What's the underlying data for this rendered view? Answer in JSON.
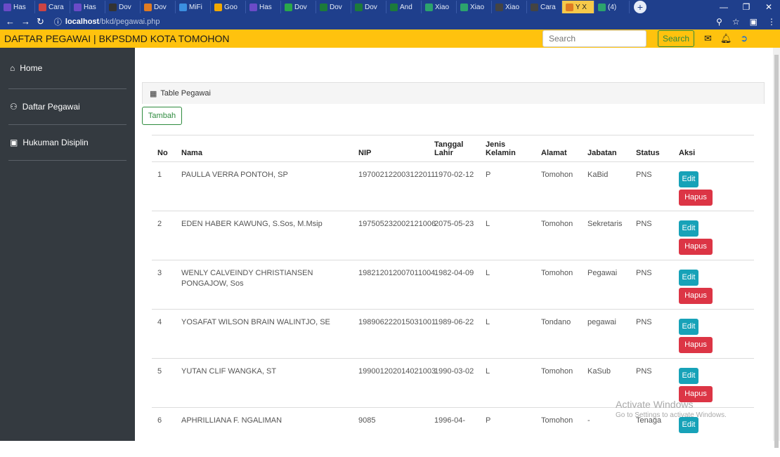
{
  "browser": {
    "tabs": [
      "Has",
      "Cara",
      "Has",
      "Dov",
      "Dov",
      "MiFi",
      "Goo",
      "Has",
      "Dov",
      "Dov",
      "Dov",
      "And",
      "Xiao",
      "Xiao",
      "Xiao",
      "Cara",
      "Y X",
      "(4)"
    ],
    "active_tab_index": 16,
    "url_host": "localhost",
    "url_path": "/bkd/pegawai.php"
  },
  "header": {
    "title": "DAFTAR PEGAWAI | BKPSDMD KOTA TOMOHON",
    "search_placeholder": "Search",
    "search_button": "Search"
  },
  "sidebar": {
    "items": [
      {
        "label": "Home",
        "icon": "home-icon"
      },
      {
        "label": "Daftar Pegawai",
        "icon": "users-icon"
      },
      {
        "label": "Hukuman Disiplin",
        "icon": "briefcase-icon"
      }
    ]
  },
  "card": {
    "title": "Table Pegawai",
    "add_button": "Tambah"
  },
  "table": {
    "columns": [
      "No",
      "Nama",
      "NIP",
      "Tanggal Lahir",
      "Jenis Kelamin",
      "Alamat",
      "Jabatan",
      "Status",
      "Aksi"
    ],
    "edit_label": "Edit",
    "delete_label": "Hapus",
    "rows": [
      {
        "no": "1",
        "nama": "PAULLA VERRA PONTOH, SP",
        "nip": "197002122003122011",
        "tgl": "1970-02-12",
        "jk": "P",
        "alamat": "Tomohon",
        "jabatan": "KaBid",
        "status": "PNS"
      },
      {
        "no": "2",
        "nama": "EDEN HABER KAWUNG, S.Sos, M.Msip",
        "nip": "197505232002121006",
        "tgl": "2075-05-23",
        "jk": "L",
        "alamat": "Tomohon",
        "jabatan": "Sekretaris",
        "status": "PNS"
      },
      {
        "no": "3",
        "nama": "WENLY CALVEINDY CHRISTIANSEN PONGAJOW, Sos",
        "nip": "198212012007011004",
        "tgl": "1982-04-09",
        "jk": "L",
        "alamat": "Tomohon",
        "jabatan": "Pegawai",
        "status": "PNS"
      },
      {
        "no": "4",
        "nama": "YOSAFAT WILSON BRAIN WALINTJO, SE",
        "nip": "198906222015031001",
        "tgl": "1989-06-22",
        "jk": "L",
        "alamat": "Tondano",
        "jabatan": "pegawai",
        "status": "PNS"
      },
      {
        "no": "5",
        "nama": "YUTAN CLIF WANGKA, ST",
        "nip": "199001202014021003",
        "tgl": "1990-03-02",
        "jk": "L",
        "alamat": "Tomohon",
        "jabatan": "KaSub",
        "status": "PNS"
      },
      {
        "no": "6",
        "nama": "APHRILLIANA F. NGALIMAN",
        "nip": "9085",
        "tgl": "1996-04-",
        "jk": "P",
        "alamat": "Tomohon",
        "jabatan": "-",
        "status": "Tenaga"
      }
    ]
  },
  "watermark": {
    "line1": "Activate Windows",
    "line2": "Go to Settings to activate Windows."
  },
  "colors": {
    "header": "#ffc20e",
    "sidebar": "#343a40",
    "edit": "#17a2b8",
    "delete": "#dc3545"
  }
}
